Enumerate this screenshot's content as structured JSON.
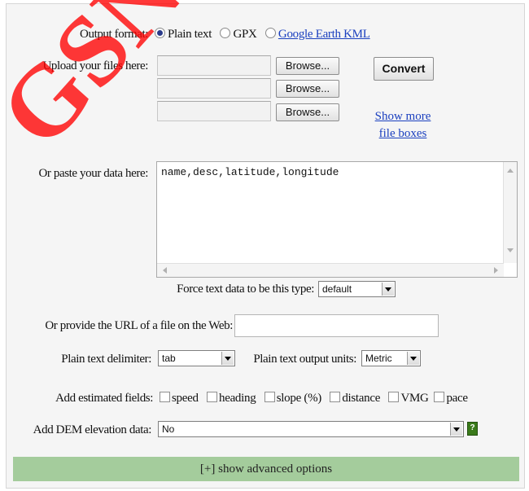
{
  "watermark": {
    "text": "GSN.",
    "color": "#ff0000"
  },
  "output_format": {
    "label": "Output format:",
    "options": [
      "Plain text",
      "GPX",
      "Google Earth KML"
    ],
    "selected": "Plain text"
  },
  "upload": {
    "label": "Upload your files here:",
    "browse_label": "Browse...",
    "convert_label": "Convert",
    "show_more": [
      "Show more",
      "file boxes"
    ]
  },
  "paste": {
    "label": "Or paste your data here:",
    "value": "name,desc,latitude,longitude"
  },
  "force_type": {
    "label": "Force text data to be this type:",
    "value": "default"
  },
  "url": {
    "label": "Or provide the URL of a file on the Web:",
    "value": ""
  },
  "delimiter": {
    "label": "Plain text delimiter:",
    "value": "tab"
  },
  "units": {
    "label": "Plain text output units:",
    "value": "Metric"
  },
  "estimated": {
    "label": "Add estimated fields:",
    "fields": [
      "speed",
      "heading",
      "slope (%)",
      "distance",
      "VMG",
      "pace"
    ]
  },
  "dem": {
    "label": "Add DEM elevation data:",
    "value": "No",
    "help_icon": "?"
  },
  "advanced": {
    "label": "[+] show advanced options"
  },
  "colors": {
    "panel": "#f5f5f5",
    "advanced_bar": "#a4cc9c",
    "link": "#1a3fbf",
    "help": "#3a7a1a"
  }
}
